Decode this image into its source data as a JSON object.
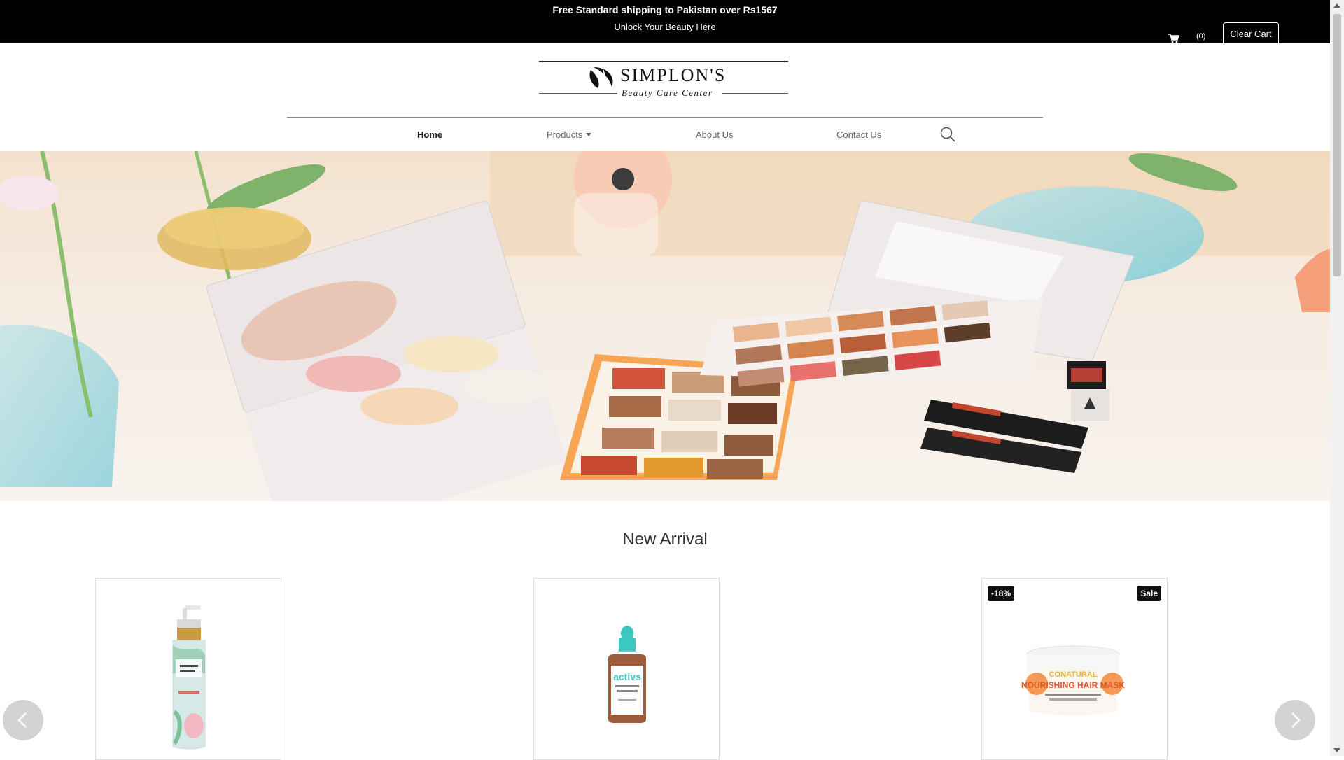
{
  "announcement": {
    "line1": "Free Standard shipping to Pakistan over Rs1567",
    "line2": "Unlock Your Beauty Here"
  },
  "cart": {
    "icon": "cart-icon",
    "count": "(0)",
    "clear_label": "Clear Cart"
  },
  "logo": {
    "name": "SIMPLON'S",
    "tagline": "Beauty Care Center"
  },
  "nav": {
    "home": "Home",
    "products": "Products",
    "about": "About Us",
    "contact": "Contact Us",
    "search_icon": "search-icon"
  },
  "hero": {
    "image": "makeup-palettes-hero-image"
  },
  "section": {
    "title": "New Arrival"
  },
  "products": [
    {
      "image": "moisturizing-body-lotion-image",
      "badges": []
    },
    {
      "image": "super-actives-serum-image",
      "badges": []
    },
    {
      "image": "nourishing-hair-mask-image",
      "badges": [
        "-18%",
        "Sale"
      ]
    }
  ],
  "carousel": {
    "prev_icon": "chevron-left-icon",
    "next_icon": "chevron-right-icon"
  },
  "colors": {
    "topbar": "#000000",
    "accent_teal": "#3cc7c0"
  }
}
